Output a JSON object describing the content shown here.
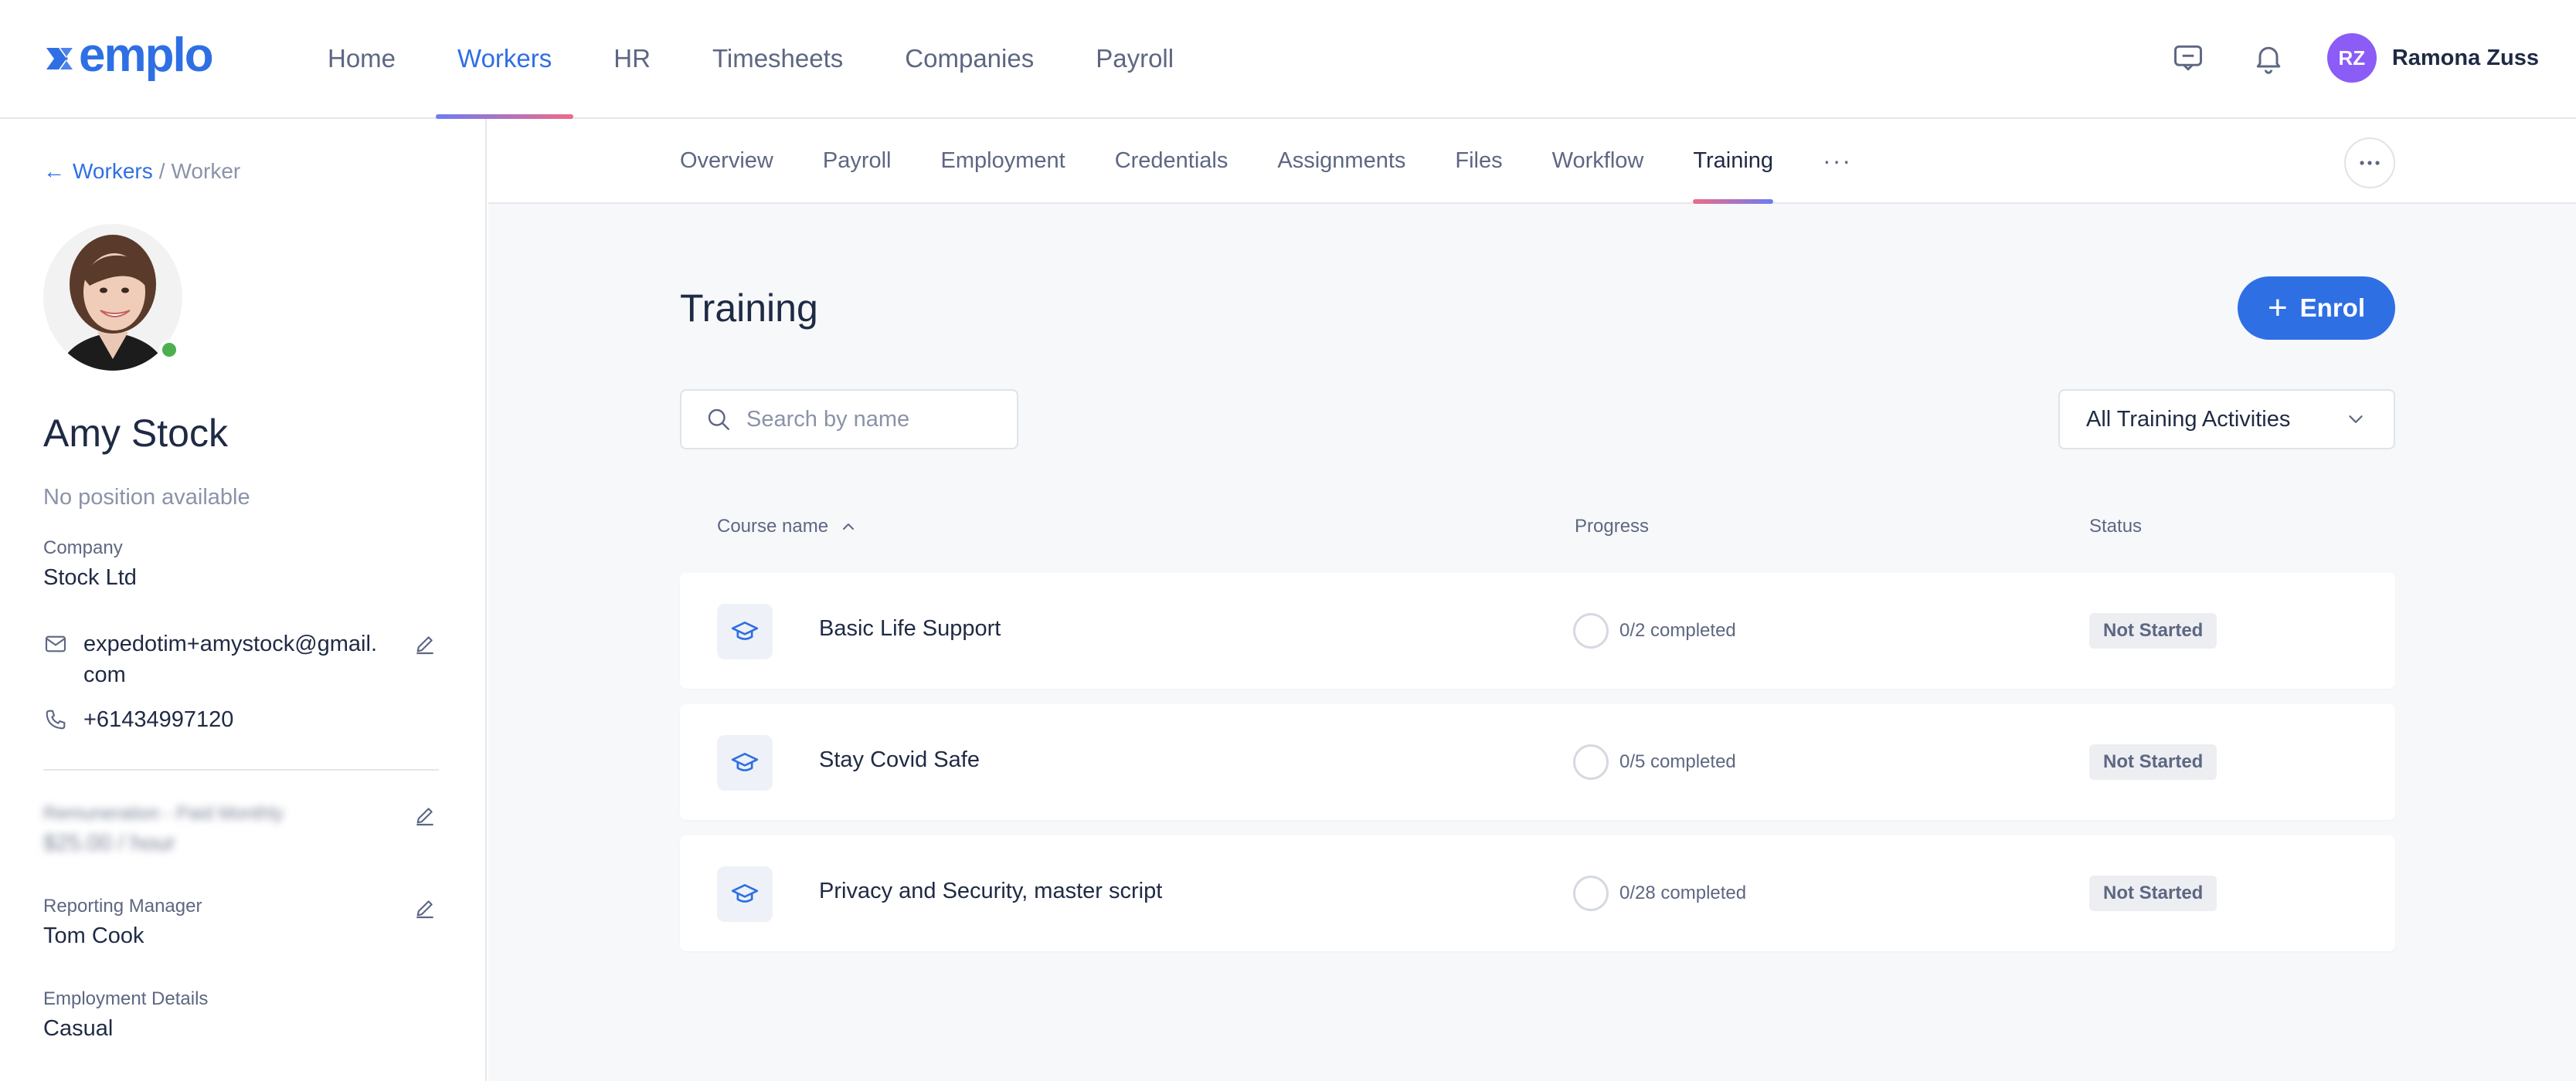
{
  "app": {
    "logo": "xemplo",
    "nav": [
      "Home",
      "Workers",
      "HR",
      "Timesheets",
      "Companies",
      "Payroll"
    ],
    "active_nav": "Workers",
    "user": {
      "initials": "RZ",
      "name": "Ramona Zuss",
      "avatar_color": "#8b5cf6"
    },
    "accent_color": "#2f6fe4"
  },
  "breadcrumb": {
    "back_label": "Workers",
    "separator": "/",
    "current": "Worker"
  },
  "worker": {
    "name": "Amy Stock",
    "position": "No position available",
    "online_status_color": "#4caf50",
    "company_label": "Company",
    "company": "Stock Ltd",
    "email_line1": "expedotim+amystock@gmail.",
    "email_line2": "com",
    "phone": "+61434997120",
    "remuneration_label": "Remuneration - Paid Monthly",
    "remuneration_value": "$25.00 / hour",
    "manager_label": "Reporting Manager",
    "manager": "Tom Cook",
    "employment_label": "Employment Details",
    "employment": "Casual"
  },
  "subnav": {
    "tabs": [
      "Overview",
      "Payroll",
      "Employment",
      "Credentials",
      "Assignments",
      "Files",
      "Workflow",
      "Training"
    ],
    "active": "Training",
    "more": "···"
  },
  "training": {
    "title": "Training",
    "enrol_label": "Enrol",
    "search_placeholder": "Search by name",
    "filter_value": "All Training Activities",
    "columns": {
      "course": "Course name",
      "progress": "Progress",
      "status": "Status"
    },
    "courses": [
      {
        "name": "Basic Life Support",
        "progress": "0/2 completed",
        "status": "Not Started"
      },
      {
        "name": "Stay Covid Safe",
        "progress": "0/5 completed",
        "status": "Not Started"
      },
      {
        "name": "Privacy and Security, master script",
        "progress": "0/28 completed",
        "status": "Not Started"
      }
    ]
  }
}
